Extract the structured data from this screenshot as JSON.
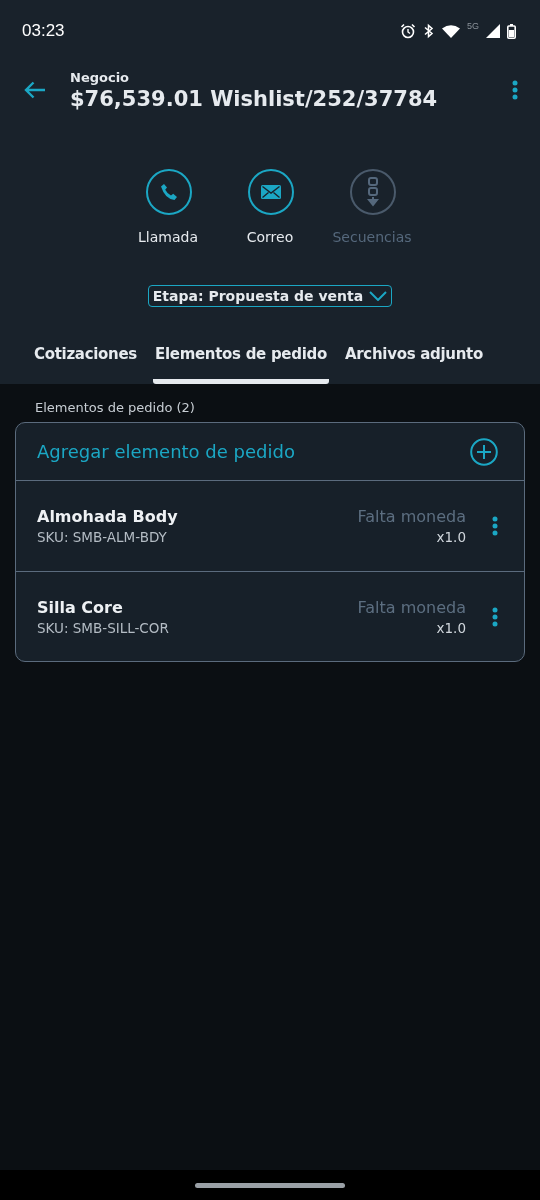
{
  "status_bar": {
    "time": "03:23",
    "network": "5G"
  },
  "header": {
    "subtitle": "Negocio",
    "title": "$76,539.01 Wishlist/252/37784"
  },
  "actions": [
    {
      "kind": "phone",
      "label": "Llamada",
      "disabled": false
    },
    {
      "kind": "mail",
      "label": "Correo",
      "disabled": false
    },
    {
      "kind": "sequence",
      "label": "Secuencias",
      "disabled": true
    }
  ],
  "stage": {
    "label": "Etapa: Propuesta de venta"
  },
  "tabs": [
    {
      "label": "Cotizaciones",
      "selected": false
    },
    {
      "label": "Elementos de pedido",
      "selected": true
    },
    {
      "label": "Archivos adjunto",
      "selected": false
    }
  ],
  "section_title": "Elementos de pedido (2)",
  "add_item": {
    "label": "Agregar elemento de pedido"
  },
  "items": [
    {
      "name": "Almohada Body",
      "sku": "SKU: SMB-ALM-BDY",
      "price": "Falta moneda",
      "quantity": "x1.0"
    },
    {
      "name": "Silla Core",
      "sku": "SKU: SMB-SILL-COR",
      "price": "Falta moneda",
      "quantity": "x1.0"
    }
  ]
}
